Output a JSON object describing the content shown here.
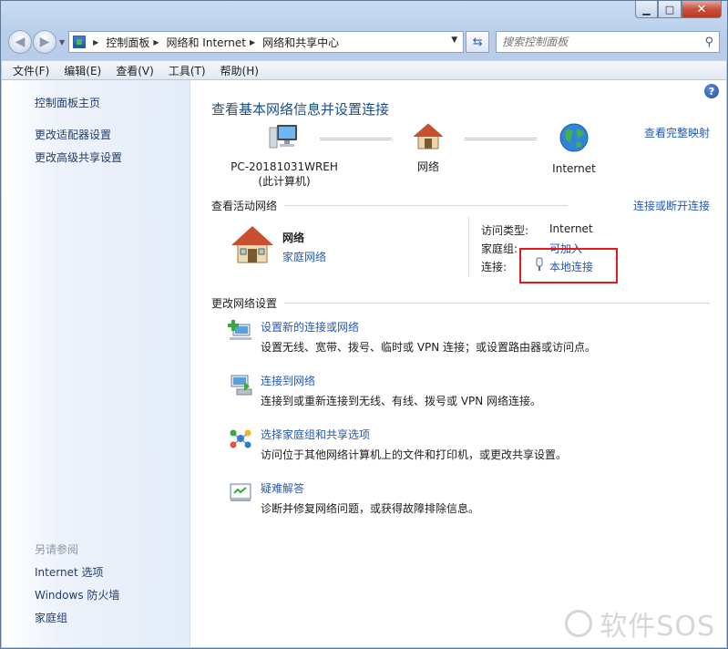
{
  "window": {
    "minimize_glyph": "▁",
    "maximize_glyph": "□",
    "close_glyph": "✕"
  },
  "address_bar": {
    "breadcrumbs": [
      "控制面板",
      "网络和 Internet",
      "网络和共享中心"
    ],
    "search_placeholder": "搜索控制面板"
  },
  "menu": [
    "文件(F)",
    "编辑(E)",
    "查看(V)",
    "工具(T)",
    "帮助(H)"
  ],
  "sidebar": {
    "links": [
      "控制面板主页",
      "更改适配器设置",
      "更改高级共享设置"
    ],
    "see_also_header": "另请参阅",
    "see_also": [
      "Internet 选项",
      "Windows 防火墙",
      "家庭组"
    ]
  },
  "main": {
    "help_glyph": "?",
    "title": "查看基本网络信息并设置连接",
    "full_map_link": "查看完整映射",
    "map_nodes": [
      {
        "label": "PC-20181031WREH",
        "sub": "(此计算机)"
      },
      {
        "label": "网络",
        "sub": ""
      },
      {
        "label": "Internet",
        "sub": ""
      }
    ],
    "active_networks_label": "查看活动网络",
    "connect_disconnect_link": "连接或断开连接",
    "active_network": {
      "name": "网络",
      "type": "家庭网络",
      "access_type_key": "访问类型:",
      "access_type_value": "Internet",
      "homegroup_key": "家庭组:",
      "homegroup_value": "可加入",
      "connection_key": "连接:",
      "connection_value": "本地连接"
    },
    "change_settings_label": "更改网络设置",
    "tasks": [
      {
        "title": "设置新的连接或网络",
        "desc": "设置无线、宽带、拨号、临时或 VPN 连接；或设置路由器或访问点。"
      },
      {
        "title": "连接到网络",
        "desc": "连接到或重新连接到无线、有线、拨号或 VPN 网络连接。"
      },
      {
        "title": "选择家庭组和共享选项",
        "desc": "访问位于其他网络计算机上的文件和打印机，或更改共享设置。"
      },
      {
        "title": "疑难解答",
        "desc": "诊断并修复网络问题，或获得故障排除信息。"
      }
    ]
  },
  "watermark": "软件SOS",
  "colors": {
    "link": "#2559b4",
    "title": "#1b4e8a",
    "highlight_box": "#e21a1a"
  }
}
